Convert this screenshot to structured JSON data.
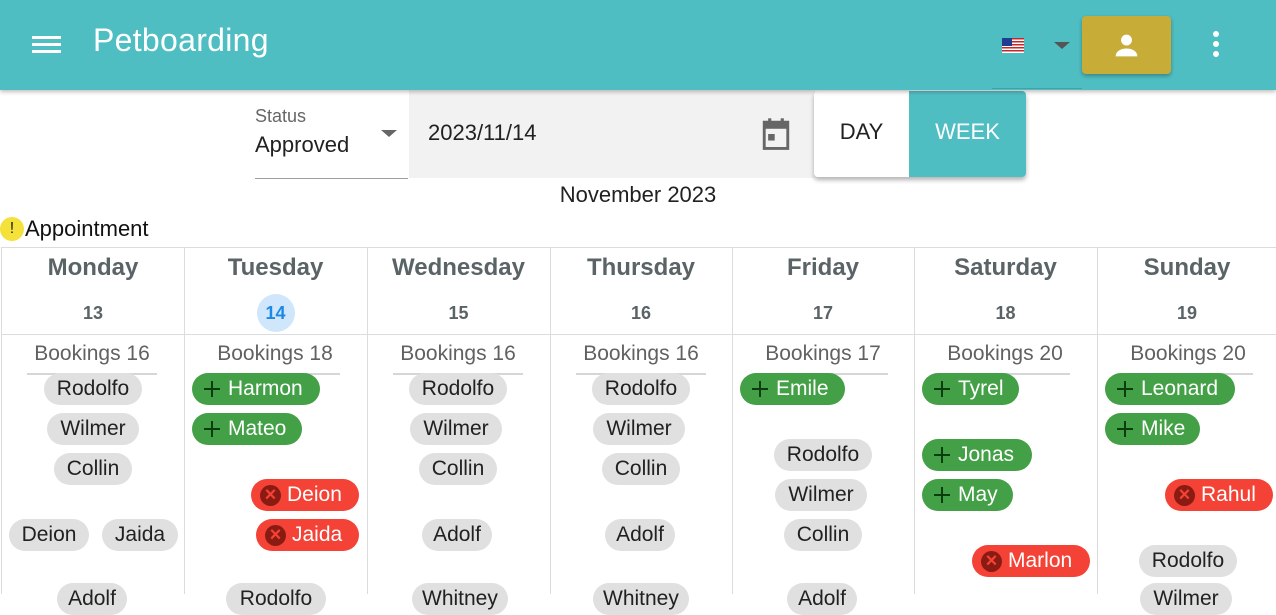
{
  "app": {
    "title": "Petboarding"
  },
  "header": {
    "language_icon": "us-flag-icon",
    "user_icon": "person-icon",
    "more_icon": "more-vert-icon",
    "accent": "#4fbec3",
    "user_button_color": "#c8ac38"
  },
  "filters": {
    "status_label": "Status",
    "status_value": "Approved",
    "date_value": "2023/11/14",
    "view_day": "DAY",
    "view_week": "WEEK",
    "active_view": "WEEK"
  },
  "calendar": {
    "month_label": "November 2023",
    "legend": {
      "icon": "!",
      "label": "Appointment"
    },
    "days": [
      {
        "name": "Monday",
        "num": "13",
        "bookings": "Bookings 16",
        "entries": [
          {
            "label": "Rodolfo",
            "kind": "grey"
          },
          {
            "label": "Wilmer",
            "kind": "grey"
          },
          {
            "label": "Collin",
            "kind": "grey"
          },
          {
            "label": "Deion",
            "kind": "grey"
          },
          {
            "label": "Jaida",
            "kind": "grey"
          },
          {
            "label": "Adolf",
            "kind": "grey"
          }
        ]
      },
      {
        "name": "Tuesday",
        "num": "14",
        "today": true,
        "bookings": "Bookings 18",
        "entries": [
          {
            "label": "Harmon",
            "kind": "green"
          },
          {
            "label": "Mateo",
            "kind": "green"
          },
          {
            "label": "Deion",
            "kind": "red"
          },
          {
            "label": "Jaida",
            "kind": "red"
          },
          {
            "label": "Rodolfo",
            "kind": "grey"
          }
        ]
      },
      {
        "name": "Wednesday",
        "num": "15",
        "bookings": "Bookings 16",
        "entries": [
          {
            "label": "Rodolfo",
            "kind": "grey"
          },
          {
            "label": "Wilmer",
            "kind": "grey"
          },
          {
            "label": "Collin",
            "kind": "grey"
          },
          {
            "label": "Adolf",
            "kind": "grey"
          },
          {
            "label": "Whitney",
            "kind": "grey"
          }
        ]
      },
      {
        "name": "Thursday",
        "num": "16",
        "bookings": "Bookings 16",
        "entries": [
          {
            "label": "Rodolfo",
            "kind": "grey"
          },
          {
            "label": "Wilmer",
            "kind": "grey"
          },
          {
            "label": "Collin",
            "kind": "grey"
          },
          {
            "label": "Adolf",
            "kind": "grey"
          },
          {
            "label": "Whitney",
            "kind": "grey"
          }
        ]
      },
      {
        "name": "Friday",
        "num": "17",
        "bookings": "Bookings 17",
        "entries": [
          {
            "label": "Emile",
            "kind": "green"
          },
          {
            "label": "Rodolfo",
            "kind": "grey"
          },
          {
            "label": "Wilmer",
            "kind": "grey"
          },
          {
            "label": "Collin",
            "kind": "grey"
          },
          {
            "label": "Adolf",
            "kind": "grey"
          }
        ]
      },
      {
        "name": "Saturday",
        "num": "18",
        "bookings": "Bookings 20",
        "entries": [
          {
            "label": "Tyrel",
            "kind": "green"
          },
          {
            "label": "Jonas",
            "kind": "green"
          },
          {
            "label": "May",
            "kind": "green"
          },
          {
            "label": "Marlon",
            "kind": "red"
          }
        ]
      },
      {
        "name": "Sunday",
        "num": "19",
        "bookings": "Bookings 20",
        "entries": [
          {
            "label": "Leonard",
            "kind": "green"
          },
          {
            "label": "Mike",
            "kind": "green"
          },
          {
            "label": "Rahul",
            "kind": "red"
          },
          {
            "label": "Rodolfo",
            "kind": "grey"
          },
          {
            "label": "Wilmer",
            "kind": "grey"
          }
        ]
      }
    ]
  }
}
